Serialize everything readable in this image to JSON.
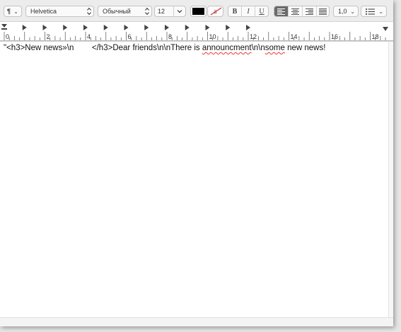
{
  "toolbar": {
    "paragraph_style_icon": "paragraph-icon",
    "font_family": "Helvetica",
    "font_style": "Обычный",
    "font_size": "12",
    "text_color": "#000000",
    "highlight_glyph": "a",
    "bold_label": "B",
    "italic_label": "I",
    "underline_label": "U",
    "alignment_active": "left",
    "line_spacing": "1,0",
    "list_icon": "list-bullets-icon"
  },
  "ruler": {
    "labels": [
      "0",
      "2",
      "4",
      "6",
      "8",
      "10",
      "12",
      "14",
      "16",
      "18"
    ]
  },
  "document": {
    "text_before": "\"<h3>New news»\\n        </h3>Dear friends\\n\\nThere is ",
    "misspelled_1": "announcment",
    "text_middle": "\\n\\n",
    "misspelled_2": "some",
    "text_after": " new news!"
  }
}
